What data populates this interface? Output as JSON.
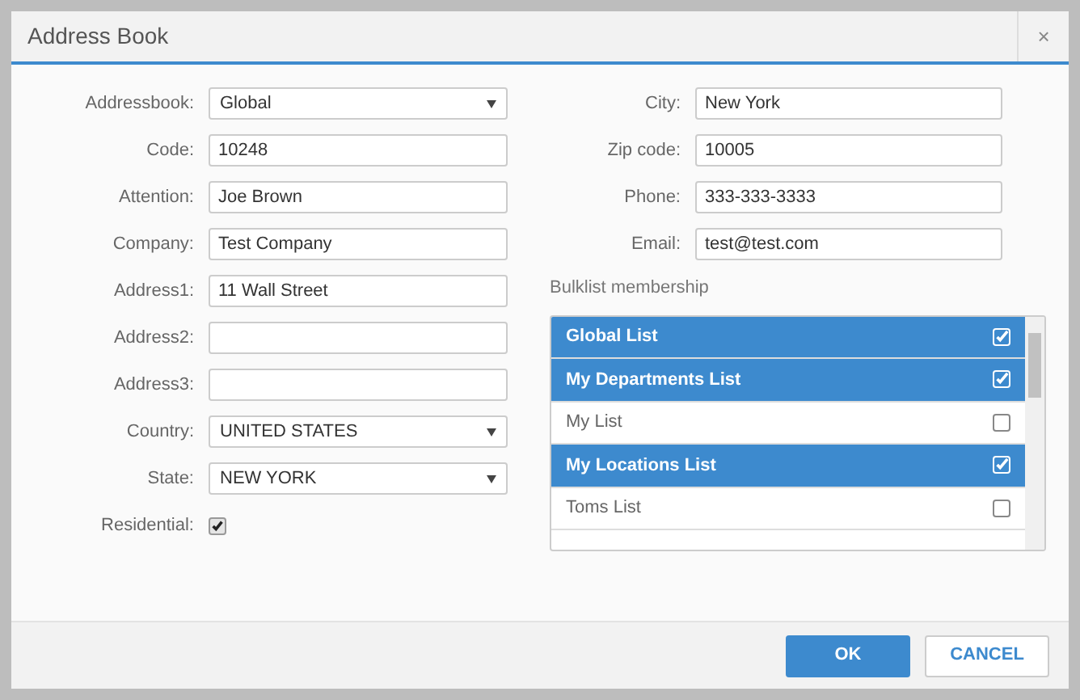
{
  "window": {
    "title": "Address Book",
    "close": "×"
  },
  "left_fields": [
    {
      "kind": "select",
      "label": "Addressbook:",
      "value": "Global"
    },
    {
      "kind": "text",
      "label": "Code:",
      "value": "10248"
    },
    {
      "kind": "text",
      "label": "Attention:",
      "value": "Joe Brown"
    },
    {
      "kind": "text",
      "label": "Company:",
      "value": "Test Company"
    },
    {
      "kind": "text",
      "label": "Address1:",
      "value": "11 Wall Street"
    },
    {
      "kind": "text",
      "label": "Address2:"
    },
    {
      "kind": "text",
      "label": "Address3:"
    },
    {
      "kind": "select",
      "label": "Country:",
      "value": "UNITED STATES"
    },
    {
      "kind": "select",
      "label": "State:",
      "value": "NEW YORK"
    },
    {
      "kind": "checkbox",
      "label": "Residential:",
      "checked": true
    }
  ],
  "right_fields": [
    {
      "kind": "text",
      "label": "City:",
      "value": "New York"
    },
    {
      "kind": "text",
      "label": "Zip code:",
      "value": "10005"
    },
    {
      "kind": "text",
      "label": "Phone:",
      "value": "333-333-3333"
    },
    {
      "kind": "text",
      "label": "Email:",
      "value": "test@test.com"
    }
  ],
  "bulklist": {
    "title": "Bulklist membership",
    "items": [
      {
        "label": "Global List",
        "checked": true
      },
      {
        "label": "My Departments List",
        "checked": true
      },
      {
        "label": "My List",
        "checked": false
      },
      {
        "label": "My Locations List",
        "checked": true
      },
      {
        "label": "Toms List",
        "checked": false
      }
    ]
  },
  "buttons": [
    {
      "kind": "primary",
      "label": "OK"
    },
    {
      "kind": "secondary",
      "label": "CANCEL"
    }
  ]
}
